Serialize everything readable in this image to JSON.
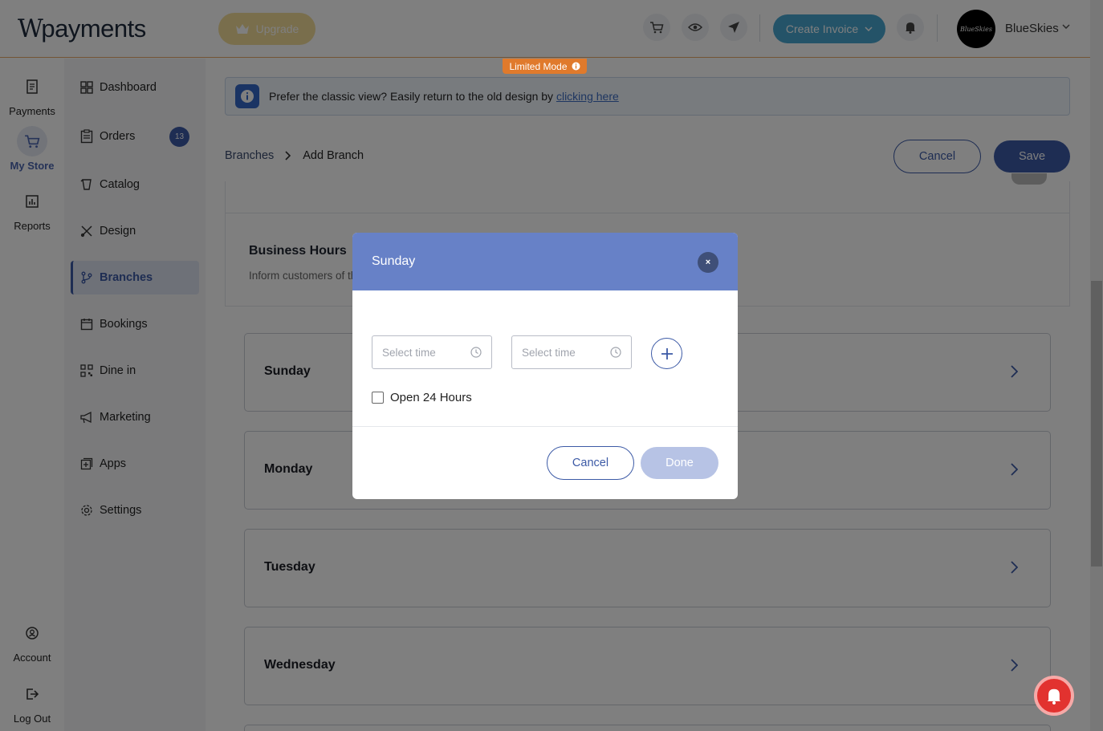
{
  "header": {
    "logo_text": "payments",
    "logo_mark": "W",
    "upgrade_label": "Upgrade",
    "create_invoice_label": "Create Invoice",
    "user_name": "BlueSkies",
    "avatar_text": "BlueSkies",
    "icons": [
      "cart-icon",
      "eye-icon",
      "send-icon",
      "bell-icon"
    ]
  },
  "rail": {
    "items": [
      {
        "label": "Payments",
        "icon": "receipt-icon"
      },
      {
        "label": "My Store",
        "icon": "cart-icon",
        "active": true
      },
      {
        "label": "Reports",
        "icon": "chart-icon"
      }
    ],
    "bottom": [
      {
        "label": "Account",
        "icon": "account-icon"
      },
      {
        "label": "Log Out",
        "icon": "logout-icon"
      }
    ]
  },
  "subnav": {
    "items": [
      {
        "label": "Dashboard",
        "icon": "grid-icon"
      },
      {
        "label": "Orders",
        "icon": "clipboard-icon",
        "badge": "13"
      },
      {
        "label": "Catalog",
        "icon": "catalog-icon"
      },
      {
        "label": "Design",
        "icon": "design-icon"
      },
      {
        "label": "Branches",
        "icon": "branch-icon",
        "active": true
      },
      {
        "label": "Bookings",
        "icon": "calendar-icon"
      },
      {
        "label": "Dine in",
        "icon": "qr-icon"
      },
      {
        "label": "Marketing",
        "icon": "megaphone-icon"
      },
      {
        "label": "Apps",
        "icon": "apps-icon"
      },
      {
        "label": "Settings",
        "icon": "gear-icon"
      }
    ]
  },
  "limited_mode": "Limited Mode",
  "banner": {
    "text": "Prefer the classic view? Easily return to the old design by",
    "link": "clicking here"
  },
  "breadcrumb": {
    "parent": "Branches",
    "current": "Add Branch"
  },
  "actions": {
    "cancel": "Cancel",
    "save": "Save"
  },
  "business_hours": {
    "title": "Business Hours",
    "subtitle": "Inform customers of th",
    "days": [
      "Sunday",
      "Monday",
      "Tuesday",
      "Wednesday"
    ]
  },
  "modal": {
    "title": "Sunday",
    "close": "×",
    "start_placeholder": "Select time",
    "end_placeholder": "Select time",
    "open_24_label": "Open 24 Hours",
    "cancel_label": "Cancel",
    "done_label": "Done"
  },
  "colors": {
    "primary": "#3c5aa6",
    "modal_header": "#6781c7",
    "invoice_button": "#49a7d1",
    "limited_badge": "#e07a2c"
  }
}
